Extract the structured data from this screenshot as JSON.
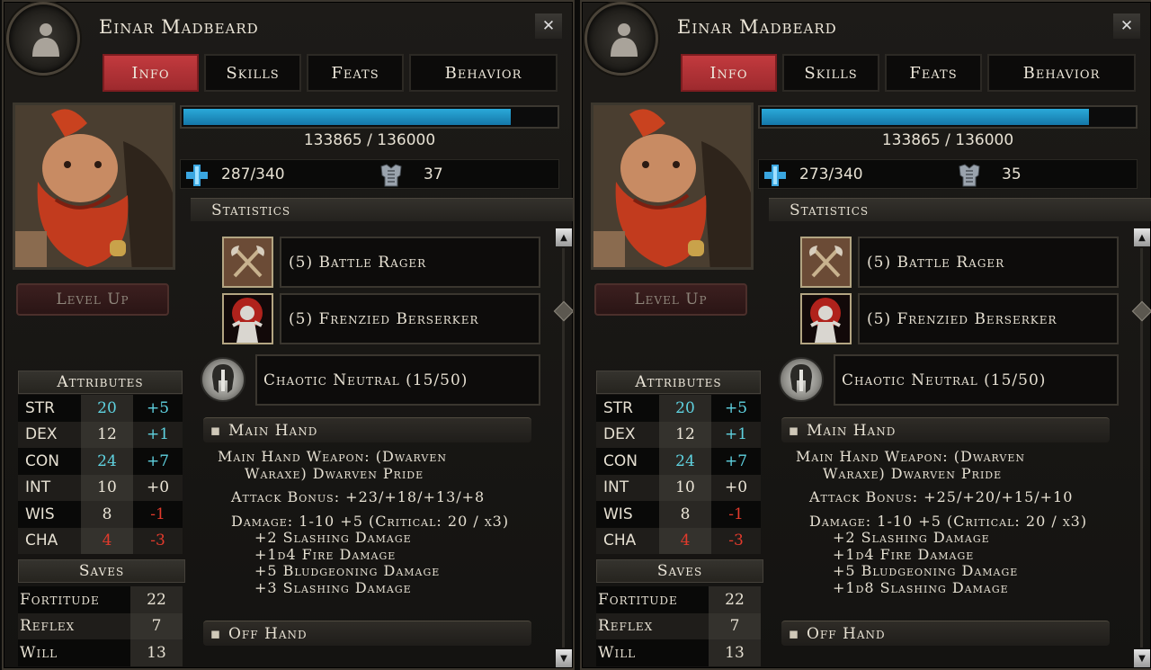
{
  "panels": [
    {
      "character_name": "Einar Madbeard",
      "close_label": "✕",
      "tabs": [
        "Info",
        "Skills",
        "Feats",
        "Behavior"
      ],
      "active_tab": "Info",
      "xp_text": "133865 / 136000",
      "xp_fraction": 0.984,
      "wounds_text": "287/340",
      "armor_class": "37",
      "level_up_label": "Level Up",
      "statistics_label": "Statistics",
      "classes": [
        {
          "label": "(5) Battle Rager",
          "icon": "crossed-axes-icon"
        },
        {
          "label": "(5) Frenzied Berserker",
          "icon": "berserker-icon"
        }
      ],
      "alignment": "Chaotic Neutral (15/50)",
      "attributes_label": "Attributes",
      "attributes": [
        {
          "name": "STR",
          "value": "20",
          "mod": "+5",
          "value_color": "hi",
          "mod_color": "hi"
        },
        {
          "name": "DEX",
          "value": "12",
          "mod": "+1",
          "value_color": "nu",
          "mod_color": "hi"
        },
        {
          "name": "CON",
          "value": "24",
          "mod": "+7",
          "value_color": "hi",
          "mod_color": "hi"
        },
        {
          "name": "INT",
          "value": "10",
          "mod": "+0",
          "value_color": "nu",
          "mod_color": "nu"
        },
        {
          "name": "WIS",
          "value": "8",
          "mod": "-1",
          "value_color": "nu",
          "mod_color": "lo"
        },
        {
          "name": "CHA",
          "value": "4",
          "mod": "-3",
          "value_color": "lo",
          "mod_color": "lo"
        }
      ],
      "saves_label": "Saves",
      "saves": [
        {
          "name": "Fortitude",
          "value": "22"
        },
        {
          "name": "Reflex",
          "value": "7"
        },
        {
          "name": "Will",
          "value": "13"
        }
      ],
      "main_hand_label": "Main Hand",
      "off_hand_label": "Off Hand",
      "weapon_line1": "Main Hand Weapon: (Dwarven",
      "weapon_line2": "Waraxe) Dwarven Pride",
      "attack_bonus": "Attack Bonus: +23/+18/+13/+8",
      "damage": "Damage: 1-10 +5 (Critical: 20 / x3)",
      "damage_lines": [
        "+2 Slashing Damage",
        "+1d4 Fire Damage",
        "+5 Bludgeoning Damage",
        "+3 Slashing Damage"
      ]
    },
    {
      "character_name": "Einar Madbeard",
      "close_label": "✕",
      "tabs": [
        "Info",
        "Skills",
        "Feats",
        "Behavior"
      ],
      "active_tab": "Info",
      "xp_text": "133865 / 136000",
      "xp_fraction": 0.984,
      "wounds_text": "273/340",
      "armor_class": "35",
      "level_up_label": "Level Up",
      "statistics_label": "Statistics",
      "classes": [
        {
          "label": "(5) Battle Rager",
          "icon": "crossed-axes-icon"
        },
        {
          "label": "(5) Frenzied Berserker",
          "icon": "berserker-icon"
        }
      ],
      "alignment": "Chaotic Neutral (15/50)",
      "attributes_label": "Attributes",
      "attributes": [
        {
          "name": "STR",
          "value": "20",
          "mod": "+5",
          "value_color": "hi",
          "mod_color": "hi"
        },
        {
          "name": "DEX",
          "value": "12",
          "mod": "+1",
          "value_color": "nu",
          "mod_color": "hi"
        },
        {
          "name": "CON",
          "value": "24",
          "mod": "+7",
          "value_color": "hi",
          "mod_color": "hi"
        },
        {
          "name": "INT",
          "value": "10",
          "mod": "+0",
          "value_color": "nu",
          "mod_color": "nu"
        },
        {
          "name": "WIS",
          "value": "8",
          "mod": "-1",
          "value_color": "nu",
          "mod_color": "lo"
        },
        {
          "name": "CHA",
          "value": "4",
          "mod": "-3",
          "value_color": "lo",
          "mod_color": "lo"
        }
      ],
      "saves_label": "Saves",
      "saves": [
        {
          "name": "Fortitude",
          "value": "22"
        },
        {
          "name": "Reflex",
          "value": "7"
        },
        {
          "name": "Will",
          "value": "13"
        }
      ],
      "main_hand_label": "Main Hand",
      "off_hand_label": "Off Hand",
      "weapon_line1": "Main Hand Weapon: (Dwarven",
      "weapon_line2": "Waraxe) Dwarven Pride",
      "attack_bonus": "Attack Bonus: +25/+20/+15/+10",
      "damage": "Damage: 1-10 +5 (Critical: 20 / x3)",
      "damage_lines": [
        "+2 Slashing Damage",
        "+1d4 Fire Damage",
        "+5 Bludgeoning Damage",
        "+1d8 Slashing Damage"
      ]
    }
  ],
  "colors": {
    "hi": "#5fd2e0",
    "lo": "#e23a2c",
    "nu": "#ece6d8",
    "tab_active": "#c23a3e",
    "xp_bar": "#2aa9d9"
  },
  "icons": {
    "emblem": "character-silhouette-icon",
    "wounds": "health-cross-icon",
    "armor": "armor-chest-icon",
    "alignment": "alignment-helm-icon",
    "scroll_up": "scroll-up-arrow-icon",
    "scroll_down": "scroll-down-arrow-icon"
  }
}
